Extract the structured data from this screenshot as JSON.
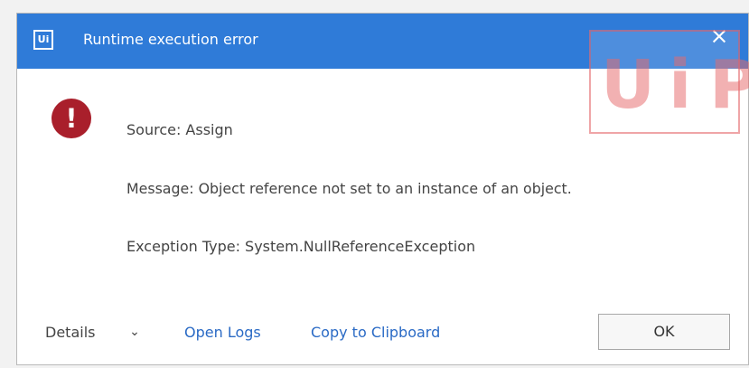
{
  "window": {
    "title": "Runtime execution error",
    "app_icon": "Ui",
    "close_icon": "close-icon"
  },
  "error": {
    "source": "Source: Assign",
    "message": "Message: Object reference not set to an instance of an object.",
    "exception_type": "Exception Type: System.NullReferenceException"
  },
  "footer": {
    "details_label": "Details",
    "open_logs_label": "Open Logs",
    "copy_label": "Copy to Clipboard",
    "ok_label": "OK"
  },
  "watermark": {
    "u": "U",
    "i": "i",
    "p": "P"
  },
  "colors": {
    "titlebar": "#2f7bd8",
    "error": "#a91f2b",
    "link": "#2a6ac5"
  }
}
